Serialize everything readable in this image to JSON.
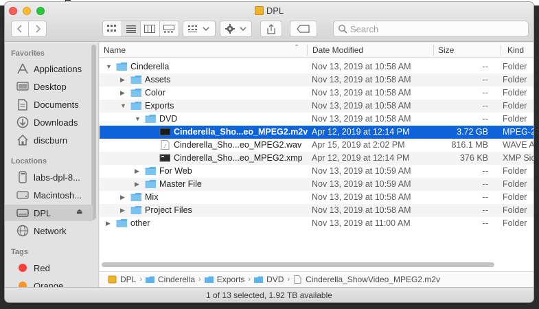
{
  "window": {
    "title": "DPL"
  },
  "toolbar": {
    "back_icon": "chevron-left-icon",
    "forward_icon": "chevron-right-icon",
    "view_modes": [
      "icon-view",
      "list-view",
      "column-view",
      "gallery-view"
    ],
    "active_view": "list-view",
    "search_placeholder": "Search"
  },
  "sidebar": {
    "favorites_label": "Favorites",
    "favorites": [
      {
        "label": "Applications",
        "icon": "applications-icon"
      },
      {
        "label": "Desktop",
        "icon": "desktop-icon"
      },
      {
        "label": "Documents",
        "icon": "documents-icon"
      },
      {
        "label": "Downloads",
        "icon": "downloads-icon"
      },
      {
        "label": "discburn",
        "icon": "home-icon"
      }
    ],
    "locations_label": "Locations",
    "locations": [
      {
        "label": "labs-dpl-8...",
        "icon": "computer-icon"
      },
      {
        "label": "Macintosh...",
        "icon": "hard-drive-icon"
      },
      {
        "label": "DPL",
        "icon": "external-drive-icon",
        "selected": true
      },
      {
        "label": "Network",
        "icon": "network-icon"
      }
    ],
    "tags_label": "Tags",
    "tags": [
      {
        "label": "Red",
        "color": "#fc3d39"
      },
      {
        "label": "Orange",
        "color": "#fd9426"
      }
    ]
  },
  "columns": {
    "name": "Name",
    "date": "Date Modified",
    "size": "Size",
    "kind": "Kind"
  },
  "files": [
    {
      "name": "Cinderella",
      "date": "Nov 13, 2019 at 10:58 AM",
      "size": "--",
      "kind": "Folder",
      "type": "folder",
      "level": 0,
      "disclosure": "open"
    },
    {
      "name": "Assets",
      "date": "Nov 13, 2019 at 10:58 AM",
      "size": "--",
      "kind": "Folder",
      "type": "folder",
      "level": 1,
      "disclosure": "closed"
    },
    {
      "name": "Color",
      "date": "Nov 13, 2019 at 10:58 AM",
      "size": "--",
      "kind": "Folder",
      "type": "folder",
      "level": 1,
      "disclosure": "closed"
    },
    {
      "name": "Exports",
      "date": "Nov 13, 2019 at 10:58 AM",
      "size": "--",
      "kind": "Folder",
      "type": "folder",
      "level": 1,
      "disclosure": "open"
    },
    {
      "name": "DVD",
      "date": "Nov 13, 2019 at 10:58 AM",
      "size": "--",
      "kind": "Folder",
      "type": "folder",
      "level": 2,
      "disclosure": "open"
    },
    {
      "name": "Cinderella_Sho...eo_MPEG2.m2v",
      "date": "Apr 12, 2019 at 12:14 PM",
      "size": "3.72 GB",
      "kind": "MPEG-2",
      "type": "video",
      "level": 3,
      "disclosure": "none",
      "selected": true
    },
    {
      "name": "Cinderella_Sho...eo_MPEG2.wav",
      "date": "Apr 15, 2019 at 2:02 PM",
      "size": "816.1 MB",
      "kind": "WAVE A",
      "type": "audio",
      "level": 3,
      "disclosure": "none"
    },
    {
      "name": "Cinderella_Sho...eo_MPEG2.xmp",
      "date": "Apr 12, 2019 at 12:14 PM",
      "size": "376 KB",
      "kind": "XMP Sid",
      "type": "doc",
      "level": 3,
      "disclosure": "none"
    },
    {
      "name": "For Web",
      "date": "Nov 13, 2019 at 10:59 AM",
      "size": "--",
      "kind": "Folder",
      "type": "folder",
      "level": 2,
      "disclosure": "closed"
    },
    {
      "name": "Master File",
      "date": "Nov 13, 2019 at 10:59 AM",
      "size": "--",
      "kind": "Folder",
      "type": "folder",
      "level": 2,
      "disclosure": "closed"
    },
    {
      "name": "Mix",
      "date": "Nov 13, 2019 at 10:58 AM",
      "size": "--",
      "kind": "Folder",
      "type": "folder",
      "level": 1,
      "disclosure": "closed"
    },
    {
      "name": "Project Files",
      "date": "Nov 13, 2019 at 10:58 AM",
      "size": "--",
      "kind": "Folder",
      "type": "folder",
      "level": 1,
      "disclosure": "closed"
    },
    {
      "name": "other",
      "date": "Nov 13, 2019 at 11:00 AM",
      "size": "--",
      "kind": "Folder",
      "type": "folder",
      "level": 0,
      "disclosure": "closed"
    }
  ],
  "path": [
    "DPL",
    "Cinderella",
    "Exports",
    "DVD",
    "Cinderella_ShowVideo_MPEG2.m2v"
  ],
  "status": "1 of 13 selected, 1.92 TB available",
  "colors": {
    "selection": "#0f63d8",
    "folder": "#5fb2ea"
  }
}
